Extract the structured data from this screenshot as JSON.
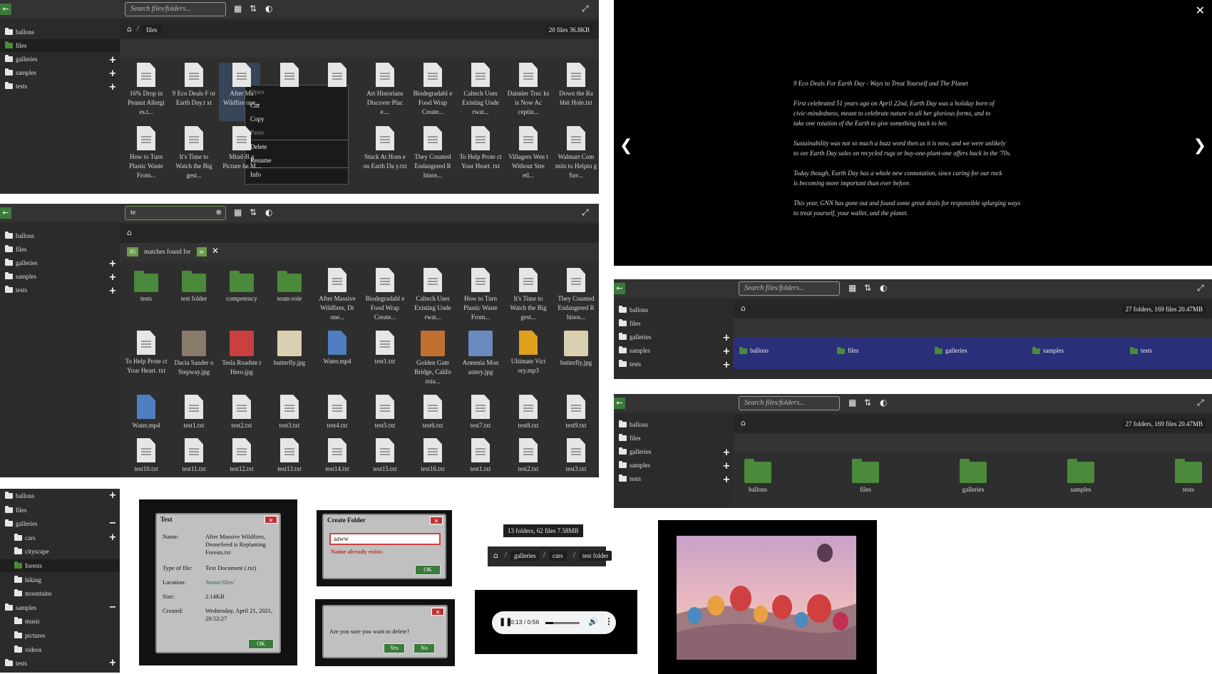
{
  "common": {
    "search_placeholder": "Search files/folders...",
    "close_x": "✕",
    "ok": "OK"
  },
  "sidebar_roots": [
    "ballons",
    "files",
    "galleries",
    "samples",
    "tests"
  ],
  "panel1": {
    "breadcrumb": "files",
    "status": "20 files 36.8KB",
    "row1": [
      "16% Drop in Peanut Allergi es.t...",
      "9 Eco Deals F or Earth Day.t xt",
      "After Ma Wildfire one...",
      "",
      "",
      "Art Historians Discover Plac e....",
      "Biodegradabl e Food Wrap Create...",
      "Caltech Uses Existing Unde rwat...",
      "Daimler Truc ks is Now Ac ceptin...",
      "Down the Ra bbit Hole.txt"
    ],
    "row2": [
      "How to Turn Plastic Waste From...",
      "It's Time to Watch the Big gest...",
      "Mind-B g Picture he M...",
      "",
      "",
      "Stuck At Hom e on Earth Da y.txt",
      "They Counted Endangered R hinos...",
      "To Help Prote ct Your Heart. txt",
      "Villagers Wen t Without Stre etl...",
      "Walmart Com mits to Helpin g Sav..."
    ],
    "context_menu": [
      "Open",
      "Cut",
      "Copy",
      "Paste",
      "Delete",
      "Rename",
      "Info"
    ]
  },
  "panel2": {
    "search_value": "te",
    "match_count": "85",
    "match_text": "matches found for",
    "match_term": "te",
    "row1": [
      "tests",
      "test folder",
      "competency",
      "team-role",
      "After Massive Wildfires, Dr one...",
      "Biodegradabl e Food Wrap Create...",
      "Caltech Uses Existing Unde rwat...",
      "How to Turn Plastic Waste From...",
      "It's Time to Watch the Big gest...",
      "They Counted Endangered R hinos..."
    ],
    "row2": [
      "To Help Prote ct Your Heart. txt",
      "Dacia Sander o Stepway.jpg",
      "Tesla Roadste r Hero.jpg",
      "butterfly.jpg",
      "Water.mp4",
      "test1.txt",
      "Golden Gate Bridge, Califo rnia...",
      "Armenia Mon astery.jpg",
      "Ultimate Vict ory.mp3",
      "butterfly.jpg"
    ],
    "row3": [
      "Water.mp4",
      "test1.txt",
      "test2.txt",
      "test3.txt",
      "test4.txt",
      "test5.txt",
      "test6.txt",
      "test7.txt",
      "test8.txt",
      "test9.txt"
    ],
    "row4": [
      "test10.txt",
      "test11.txt",
      "test12.txt",
      "test13.txt",
      "test14.txt",
      "test15.txt",
      "test16.txt",
      "test1.txt",
      "test2.txt",
      "test3.txt"
    ]
  },
  "viewer": {
    "title": "9 Eco Deals For Earth Day - Ways to Treat Yourself and The Planet",
    "p1a": "First celebrated 51 years ago on April 22nd, Earth Day was a holiday born of",
    "p1b": "civic-mindedness, meant to celebrate nature in all her glorious forms, and to",
    "p1c": "take one rotation of the Earth to give something back to her.",
    "p2a": "Sustainability was not so much a buzz word then as it is now, and we were unlikely",
    "p2b": "to see Earth Day sales on recycled rugs or buy-one-plant-one offers back in the '70s.",
    "p3a": "Today though, Earth Day has a whole new connotation, since caring for our rock",
    "p3b": "is becoming more important than ever before.",
    "p4a": "This year, GNN has gone out and found some great deals for responsible splurging ways",
    "p4b": "to treat yourself, your wallet, and the planet."
  },
  "panel3": {
    "status": "27 folders, 169 files 20.47MB"
  },
  "panel4": {
    "status": "27 folders, 169 files 20.47MB"
  },
  "tree": {
    "galleries_children": [
      "cars",
      "cityscape",
      "forests",
      "hiking",
      "mountains"
    ],
    "samples_children": [
      "music",
      "pictures",
      "videos"
    ]
  },
  "info_dialog": {
    "title": "Text",
    "name_label": "Name:",
    "name_value": "After Massive Wildfires, DroneSeed is Replanting Forests.txt",
    "type_label": "Type of file:",
    "type_value": "Text Document (.txt)",
    "loc_label": "Location:",
    "loc_value": "/home/files/",
    "size_label": "Size:",
    "size_value": "2.14KB",
    "created_label": "Created:",
    "created_value": "Wednesday, April 21, 2021, 20:52:27"
  },
  "create_dialog": {
    "title": "Create Folder",
    "value": "aaww",
    "error": "Name already exists"
  },
  "delete_dialog": {
    "question": "Are you sure you want to delete?",
    "yes": "Yes",
    "no": "No"
  },
  "status_small": "13 folders, 62 files 7.58MB",
  "breadcrumb_small": [
    "galleries",
    "cars",
    "test folder"
  ],
  "audio": {
    "time": "0:13 / 0:56"
  },
  "colors": {
    "accent": "#3a7a3a",
    "selection": "#2a2f7a",
    "bg": "#2b2b2b"
  }
}
